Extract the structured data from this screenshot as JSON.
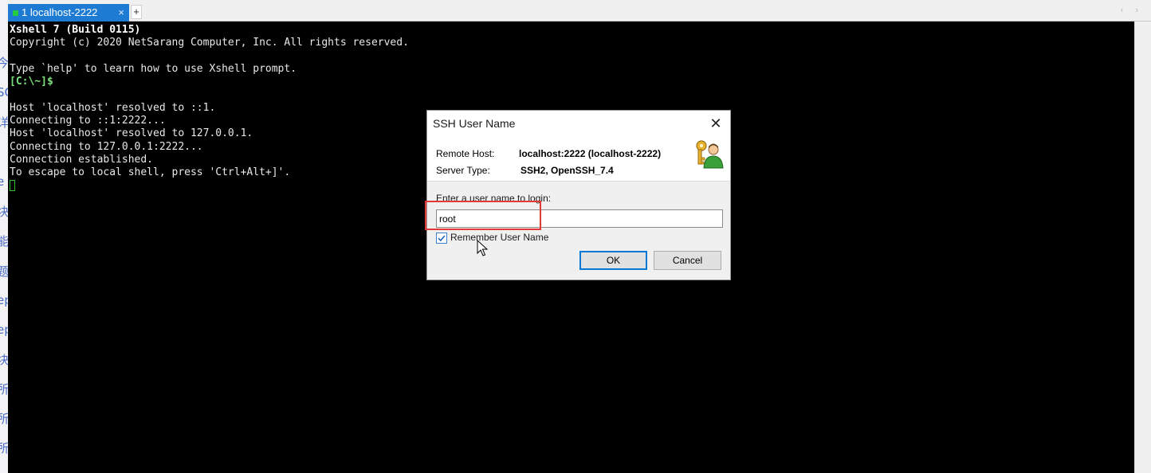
{
  "background_page": {
    "glyphs": [
      "今",
      "SC",
      "详",
      "e",
      "块",
      "能",
      "题",
      "ep",
      "ep",
      "块",
      "所",
      "所",
      "所"
    ]
  },
  "tabbar": {
    "active_tab": {
      "label": "1 localhost-2222",
      "close": "×",
      "status_color": "#27c93f"
    },
    "new_tab": "+",
    "nav_arrows": "‹ ›"
  },
  "terminal": {
    "lines": [
      "Xshell 7 (Build 0115)",
      "Copyright (c) 2020 NetSarang Computer, Inc. All rights reserved.",
      "",
      "Type `help' to learn how to use Xshell prompt.",
      "[C:\\~]$",
      "",
      "Host 'localhost' resolved to ::1.",
      "Connecting to ::1:2222...",
      "Host 'localhost' resolved to 127.0.0.1.",
      "Connecting to 127.0.0.1:2222...",
      "Connection established.",
      "To escape to local shell, press 'Ctrl+Alt+]'."
    ]
  },
  "dialog": {
    "title": "SSH User Name",
    "close": "✕",
    "remote_host_label": "Remote Host:",
    "remote_host_value": "localhost:2222 (localhost-2222)",
    "server_type_label": "Server Type:",
    "server_type_value": "SSH2, OpenSSH_7.4",
    "prompt": "Enter a user name to login:",
    "username": "root",
    "remember_label": "Remember User Name",
    "remember_checked": true,
    "ok": "OK",
    "cancel": "Cancel",
    "highlight_color": "#e53935"
  }
}
